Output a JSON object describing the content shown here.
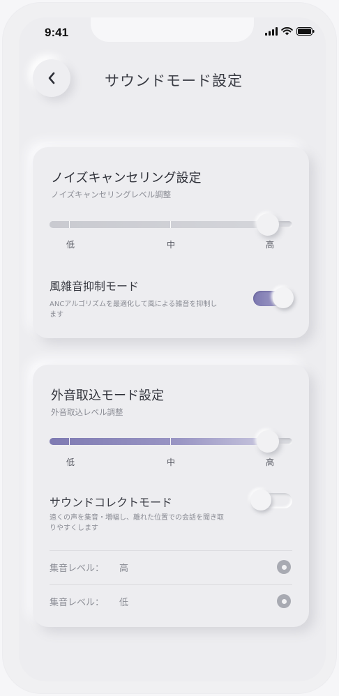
{
  "status_bar": {
    "time": "9:41"
  },
  "header": {
    "title": "サウンドモード設定"
  },
  "anc_card": {
    "title": "ノイズキャンセリング設定",
    "subtitle": "ノイズキャンセリングレベル調整",
    "slider": {
      "labels": [
        "低",
        "中",
        "高"
      ],
      "value_fraction": 0.9
    },
    "wind_mode": {
      "title": "風雑音抑制モード",
      "description": "ANCアルゴリズムを最適化して風による雑音を抑制します",
      "enabled": true
    }
  },
  "ambient_card": {
    "title": "外音取込モード設定",
    "subtitle": "外音取込レベル調整",
    "slider": {
      "labels": [
        "低",
        "中",
        "高"
      ],
      "value_fraction": 0.9
    },
    "sound_collect": {
      "title": "サウンドコレクトモード",
      "description": "遠くの声を集音・増幅し、離れた位置での会話を聞き取りやすくします",
      "enabled": false
    },
    "levels": [
      {
        "label": "集音レベル：",
        "value": "高"
      },
      {
        "label": "集音レベル：",
        "value": "低"
      }
    ]
  },
  "colors": {
    "accent": "#8b87bd",
    "background": "#ededf0"
  }
}
